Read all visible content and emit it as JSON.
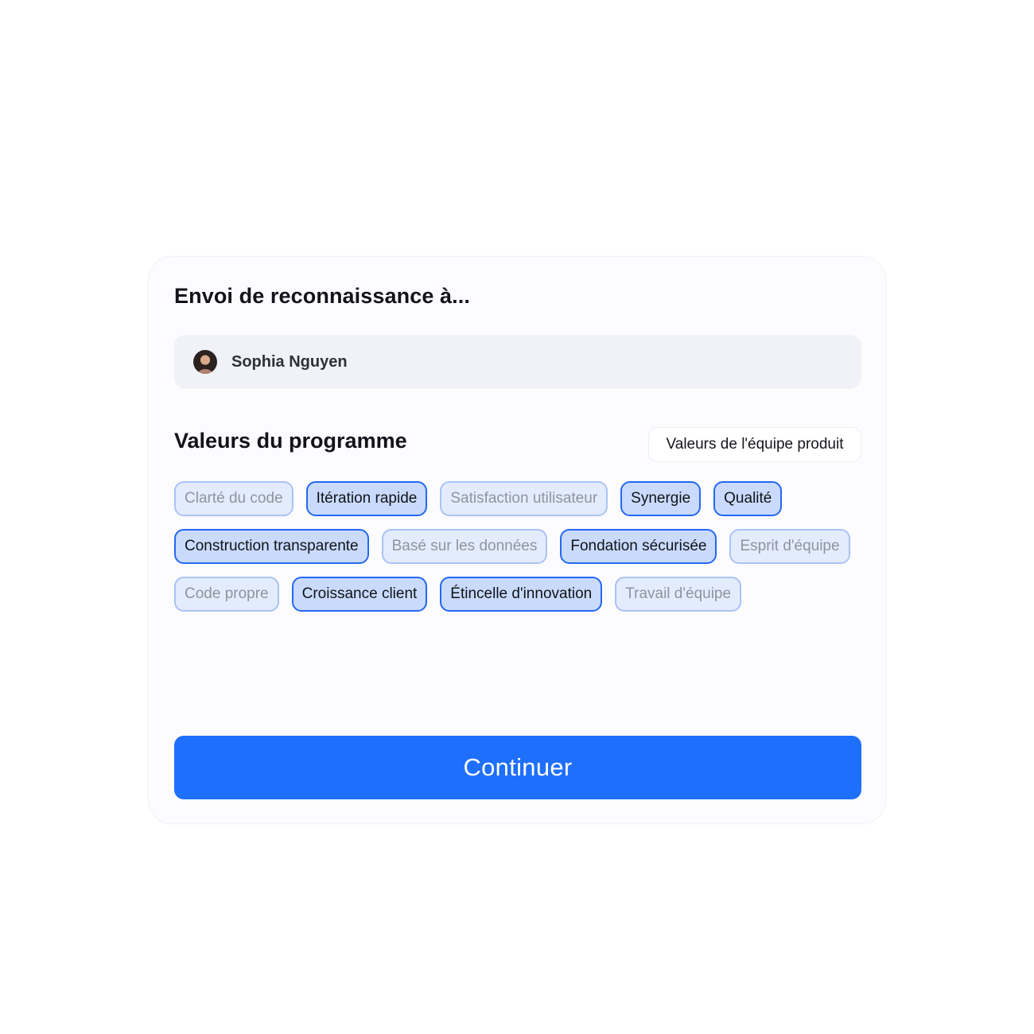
{
  "form": {
    "heading": "Envoi de reconnaissance à...",
    "recipient": {
      "name": "Sophia Nguyen",
      "avatar_icon": "avatar-photo"
    },
    "values_section": {
      "title": "Valeurs du programme",
      "team_values_button": "Valeurs de l'équipe produit",
      "chips": [
        {
          "label": "Clarté du code",
          "selected": false
        },
        {
          "label": "Itération rapide",
          "selected": true
        },
        {
          "label": "Satisfaction utilisateur",
          "selected": false
        },
        {
          "label": "Synergie",
          "selected": true
        },
        {
          "label": "Qualité",
          "selected": true
        },
        {
          "label": "Construction transparente",
          "selected": true
        },
        {
          "label": "Basé sur les données",
          "selected": false
        },
        {
          "label": "Fondation sécurisée",
          "selected": true
        },
        {
          "label": "Esprit d'équipe",
          "selected": false
        },
        {
          "label": "Code propre",
          "selected": false
        },
        {
          "label": "Croissance client",
          "selected": true
        },
        {
          "label": "Étincelle d'innovation",
          "selected": true
        },
        {
          "label": "Travail d'équipe",
          "selected": false
        }
      ]
    },
    "continue_label": "Continuer"
  },
  "colors": {
    "accent": "#1f6ffd",
    "chip_selected_bg": "#c9dafc",
    "chip_selected_border": "#2468f2",
    "chip_unselected_bg": "#e3ecfd",
    "chip_unselected_border": "#a9c3f6"
  }
}
